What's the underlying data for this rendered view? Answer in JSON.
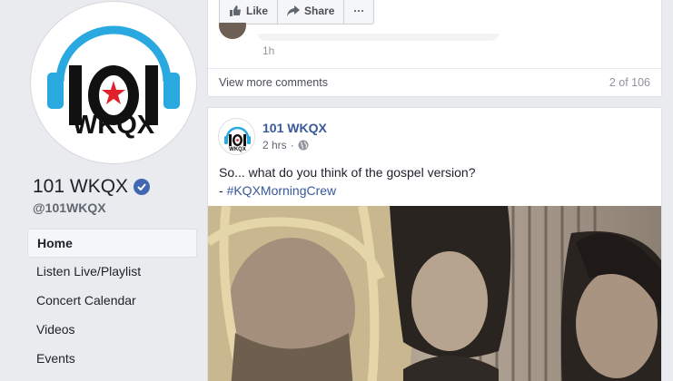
{
  "page": {
    "name": "101 WKQX",
    "handle": "@101WKQX",
    "logo_text": "101",
    "logo_subtext": "WKQX"
  },
  "nav": [
    {
      "label": "Home",
      "active": true
    },
    {
      "label": "Listen Live/Playlist",
      "active": false
    },
    {
      "label": "Concert Calendar",
      "active": false
    },
    {
      "label": "Videos",
      "active": false
    },
    {
      "label": "Events",
      "active": false
    }
  ],
  "top_card": {
    "actions": {
      "like": "Like",
      "share": "Share",
      "more": "···"
    },
    "comment_time": "1h",
    "view_more": "View more comments",
    "count": "2 of 106"
  },
  "post": {
    "author": "101 WKQX",
    "time": "2 hrs",
    "text": "So... what do you think of the gospel version?",
    "dash": "- ",
    "hashtag": "#KQXMorningCrew"
  },
  "colors": {
    "link": "#385898",
    "verified": "#4267b2",
    "logo_blue": "#29a9e0",
    "logo_red": "#e0202a"
  }
}
